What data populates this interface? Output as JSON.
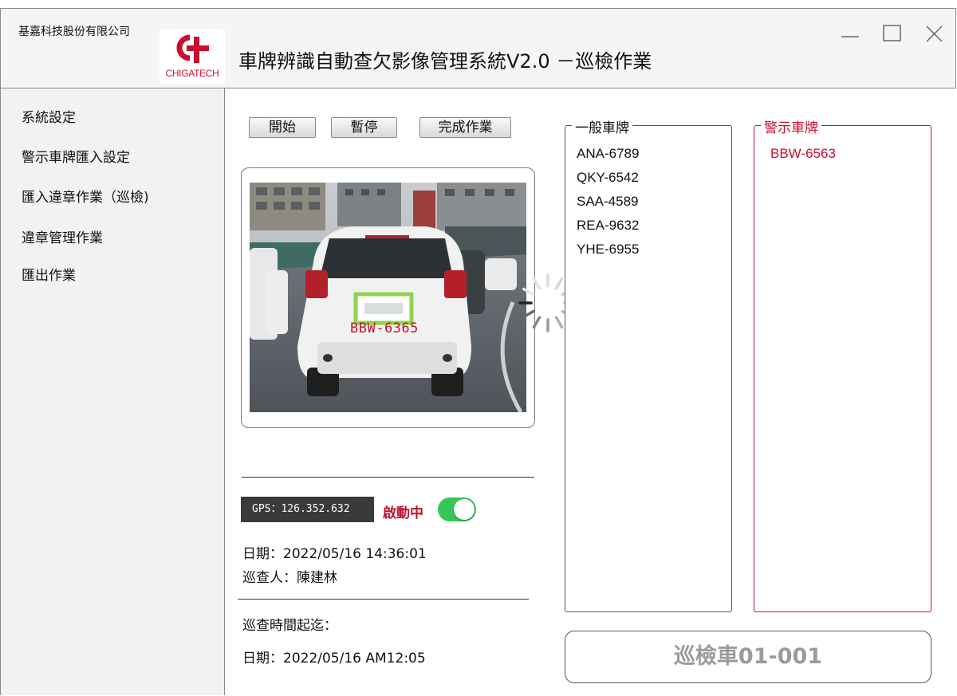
{
  "window": {
    "company": "基嘉科技股份有限公司",
    "logo_text": "CHIGATECH",
    "title": "車牌辨識自動查欠影像管理系統V2.0 －巡檢作業"
  },
  "sidebar": {
    "items": [
      {
        "label": "系統設定"
      },
      {
        "label": "警示車牌匯入設定"
      },
      {
        "label": "匯入違章作業（巡檢)"
      },
      {
        "label": "違章管理作業"
      },
      {
        "label": "匯出作業"
      }
    ]
  },
  "toolbar": {
    "start_label": "開始",
    "pause_label": "暫停",
    "finish_label": "完成作業"
  },
  "camera": {
    "detected_plate": "BBW-6365"
  },
  "status": {
    "gps": "GPS：126.352.632",
    "state": "啟動中",
    "toggle_on": true,
    "date": "日期：2022/05/16 14:36:01",
    "inspector": "巡查人：陳建林",
    "period_label": "巡查時間起迄：",
    "period_date": "日期：2022/05/16 AM12:05"
  },
  "general_plates": {
    "title": "一般車牌",
    "items": [
      "ANA-6789",
      "QKY-6542",
      "SAA-4589",
      "REA-9632",
      "YHE-6955"
    ]
  },
  "alert_plates": {
    "title": "警示車牌",
    "items": [
      "BBW-6563"
    ]
  },
  "vehicle": {
    "label": "巡檢車01-001"
  },
  "colors": {
    "alert_red": "#c8102e",
    "toggle_green": "#34c759",
    "detect_box_green": "#8dd44a"
  }
}
